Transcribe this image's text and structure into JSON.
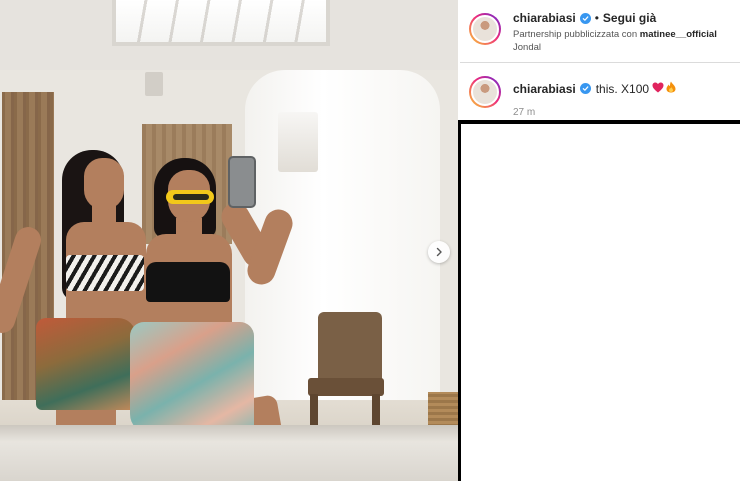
{
  "post": {
    "username": "chiarabiasi",
    "follow_label": "Segui già",
    "separator": "•",
    "partnership_prefix": "Partnership pubblicizzata con",
    "partner": "matinee__officiаl",
    "location": "Jondal"
  },
  "comment": {
    "username": "chiarabiasi",
    "text": "this. X100",
    "emoji_heart": "❤",
    "emoji_fire": "🔥",
    "time": "27 m"
  },
  "icons": {
    "verified": "verified-badge-icon",
    "next": "chevron-right-icon"
  },
  "colors": {
    "verified_blue": "#3897f0",
    "heart_red": "#e0245e",
    "text_primary": "#262626",
    "text_secondary": "#8e8e8e"
  }
}
